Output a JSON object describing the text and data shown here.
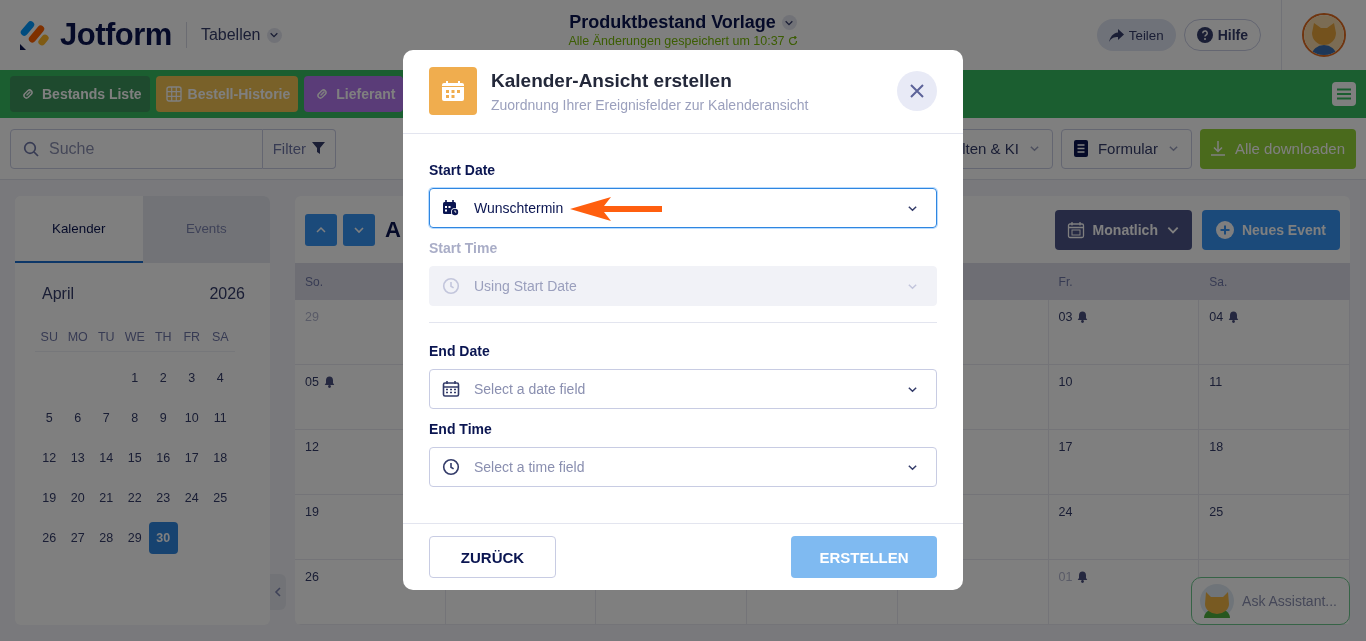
{
  "header": {
    "logo_text": "Jotform",
    "app_switcher": "Tabellen",
    "title": "Produktbestand Vorlage",
    "save_status": "Alle Änderungen gespeichert um 10:37",
    "share_button": "Teilen",
    "help_button": "Hilfe"
  },
  "table_tabs": [
    {
      "label": "Bestands Liste",
      "kind": "link"
    },
    {
      "label": "Bestell-Historie",
      "kind": "grid"
    },
    {
      "label": "Lieferant",
      "kind": "link"
    }
  ],
  "toolbar": {
    "search": {
      "placeholder": "Suche"
    },
    "filter": "Filter",
    "ai_menu": "lten & KI",
    "form_menu": "Formular",
    "download_button": "Alle downloaden"
  },
  "sidebar": {
    "tabs": [
      {
        "label": "Kalender",
        "selected": true
      },
      {
        "label": "Events",
        "selected": false
      }
    ],
    "month": "April",
    "year": "2026",
    "weekdays": [
      "SU",
      "MO",
      "TU",
      "WE",
      "TH",
      "FR",
      "SA"
    ],
    "weeks": [
      [
        {
          "day": "1",
          "selected": false
        },
        {
          "day": "2",
          "selected": false
        },
        {
          "day": "3",
          "selected": false
        },
        {
          "day": "4",
          "selected": false
        }
      ],
      [
        {
          "day": "5",
          "selected": false
        },
        {
          "day": "6",
          "selected": false
        },
        {
          "day": "7",
          "selected": false
        },
        {
          "day": "8",
          "selected": false
        },
        {
          "day": "9",
          "selected": false
        },
        {
          "day": "10",
          "selected": false
        },
        {
          "day": "11",
          "selected": false
        }
      ],
      [
        {
          "day": "12",
          "selected": false
        },
        {
          "day": "13",
          "selected": false
        },
        {
          "day": "14",
          "selected": false
        },
        {
          "day": "15",
          "selected": false
        },
        {
          "day": "16",
          "selected": false
        },
        {
          "day": "17",
          "selected": false
        },
        {
          "day": "18",
          "selected": false
        }
      ],
      [
        {
          "day": "19",
          "selected": false
        },
        {
          "day": "20",
          "selected": false
        },
        {
          "day": "21",
          "selected": false
        },
        {
          "day": "22",
          "selected": false
        },
        {
          "day": "23",
          "selected": false
        },
        {
          "day": "24",
          "selected": false
        },
        {
          "day": "25",
          "selected": false
        }
      ],
      [
        {
          "day": "26",
          "selected": false
        },
        {
          "day": "27",
          "selected": false
        },
        {
          "day": "28",
          "selected": false
        },
        {
          "day": "29",
          "selected": false
        },
        {
          "day": "30",
          "selected": true
        }
      ]
    ]
  },
  "calendar": {
    "month_title": "A",
    "view_menu": "Monatlich",
    "new_event_button": "Neues Event",
    "columns": [
      {
        "kind": "sunday",
        "header": "So.",
        "days": [
          {
            "day": "29",
            "bell": false,
            "muted": true
          },
          {
            "day": "05",
            "bell": true,
            "muted": false
          },
          {
            "day": "12",
            "bell": false,
            "muted": false
          },
          {
            "day": "19",
            "bell": false,
            "muted": false
          },
          {
            "day": "26",
            "bell": false,
            "muted": false
          }
        ]
      },
      {
        "kind": "friday",
        "header": "Fr.",
        "days": [
          {
            "day": "03",
            "bell": true,
            "muted": false
          },
          {
            "day": "10",
            "bell": false,
            "muted": false
          },
          {
            "day": "17",
            "bell": false,
            "muted": false
          },
          {
            "day": "24",
            "bell": false,
            "muted": false
          },
          {
            "day": "01",
            "bell": true,
            "muted": true
          }
        ]
      },
      {
        "kind": "saturday",
        "header": "Sa.",
        "days": [
          {
            "day": "04",
            "bell": true,
            "muted": false
          },
          {
            "day": "11",
            "bell": false,
            "muted": false
          },
          {
            "day": "18",
            "bell": false,
            "muted": false
          },
          {
            "day": "25",
            "bell": false,
            "muted": false
          }
        ]
      }
    ]
  },
  "assistant": {
    "label": "Ask Assistant..."
  },
  "modal": {
    "title": "Kalender-Ansicht erstellen",
    "subtitle": "Zuordnung Ihrer Ereignisfelder zur Kalenderansicht",
    "field_groups": [
      [
        {
          "label": "Start Date",
          "kind": "calendar-clock",
          "value": "Wunschtermin",
          "focused": true,
          "disabled": false,
          "annotated": true
        },
        {
          "label": "Start Time",
          "kind": "clock",
          "placeholder": "Using Start Date",
          "focused": false,
          "disabled": true,
          "annotated": false
        }
      ],
      [
        {
          "label": "End Date",
          "kind": "calendar",
          "placeholder": "Select a date field",
          "focused": false,
          "disabled": false,
          "annotated": false
        },
        {
          "label": "End Time",
          "kind": "clock",
          "placeholder": "Select a time field",
          "focused": false,
          "disabled": false,
          "annotated": false
        }
      ]
    ],
    "back_button": "ZURÜCK",
    "create_button": {
      "label": "ERSTELLEN",
      "disabled": true
    }
  }
}
